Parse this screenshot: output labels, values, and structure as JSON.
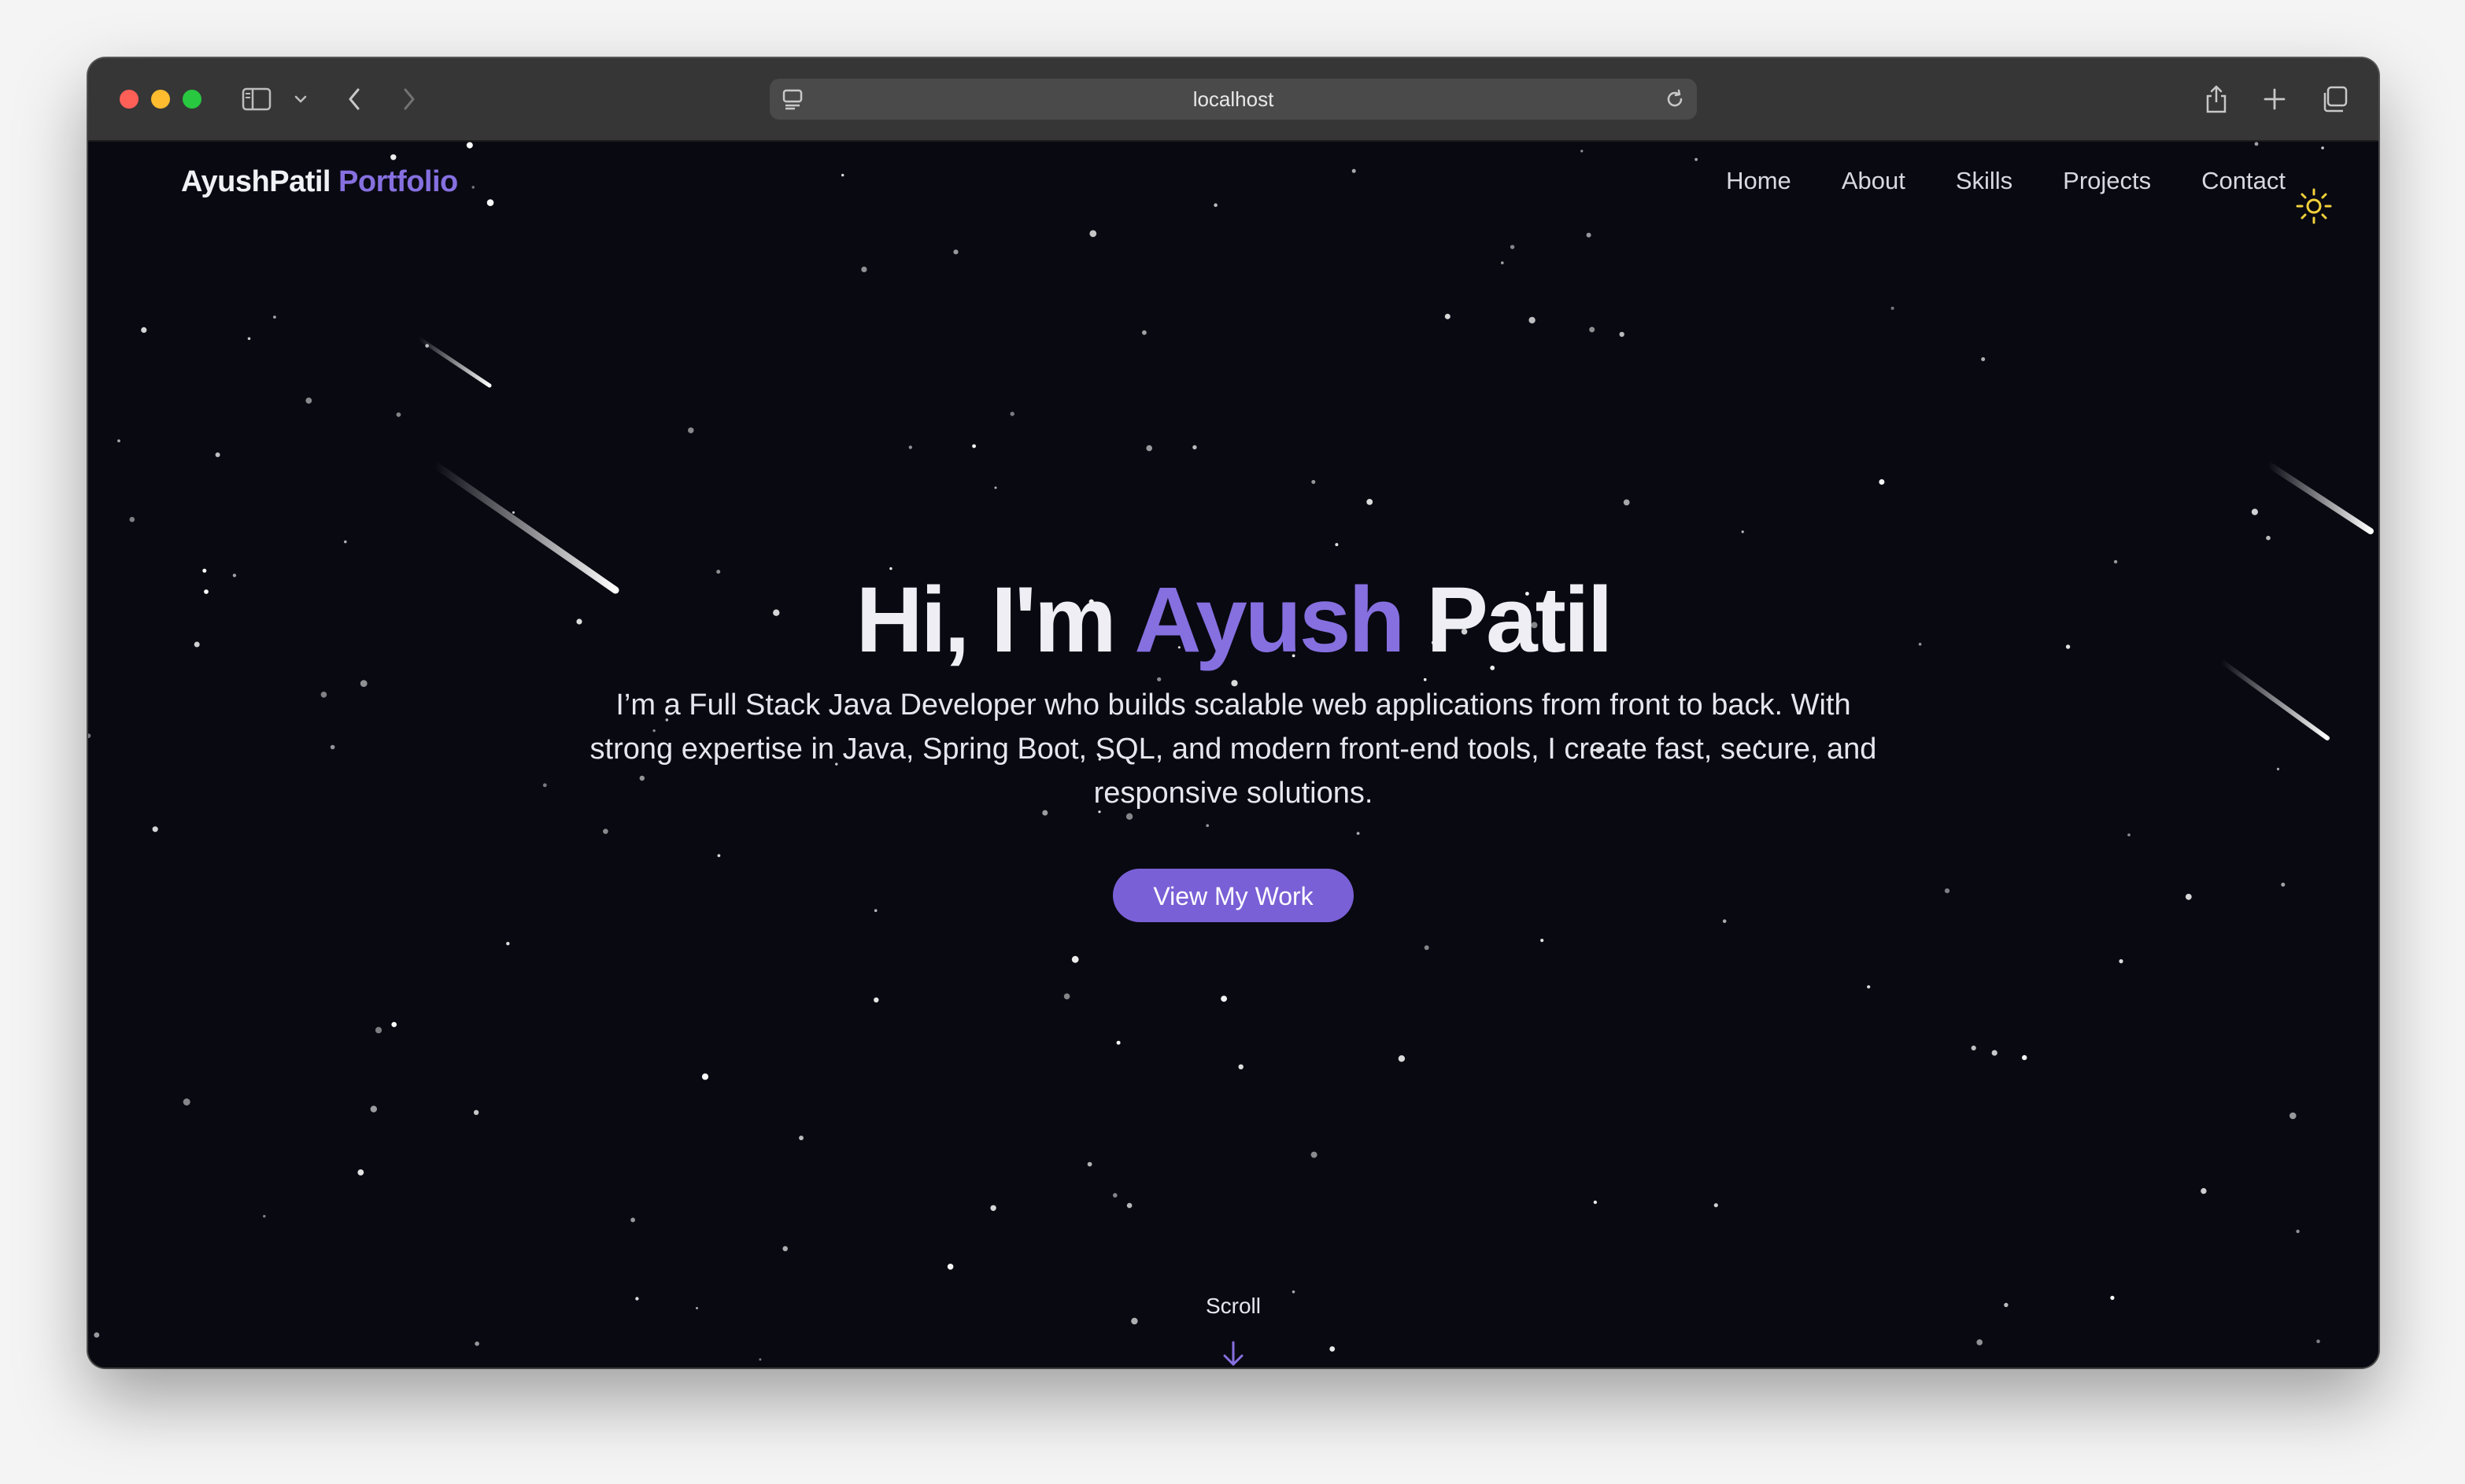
{
  "browser": {
    "url": "localhost"
  },
  "nav": {
    "logo_primary": "AyushPatil",
    "logo_accent": "Portfolio",
    "links": [
      "Home",
      "About",
      "Skills",
      "Projects",
      "Contact"
    ],
    "theme_icon": "sun-icon"
  },
  "hero": {
    "title_prefix": "Hi, I'm",
    "title_accent": "Ayush",
    "title_suffix": "Patil",
    "description": "I’m a Full Stack Java Developer who builds scalable web applications from front to back. With strong expertise in Java, Spring Boot, SQL, and modern front-end tools, I create fast, secure, and responsive solutions.",
    "cta_label": "View My Work",
    "scroll_label": "Scroll"
  },
  "colors": {
    "accent": "#8670e0",
    "button": "#7a60d6",
    "page_background": "#090912",
    "sun": "#f2d13a"
  }
}
